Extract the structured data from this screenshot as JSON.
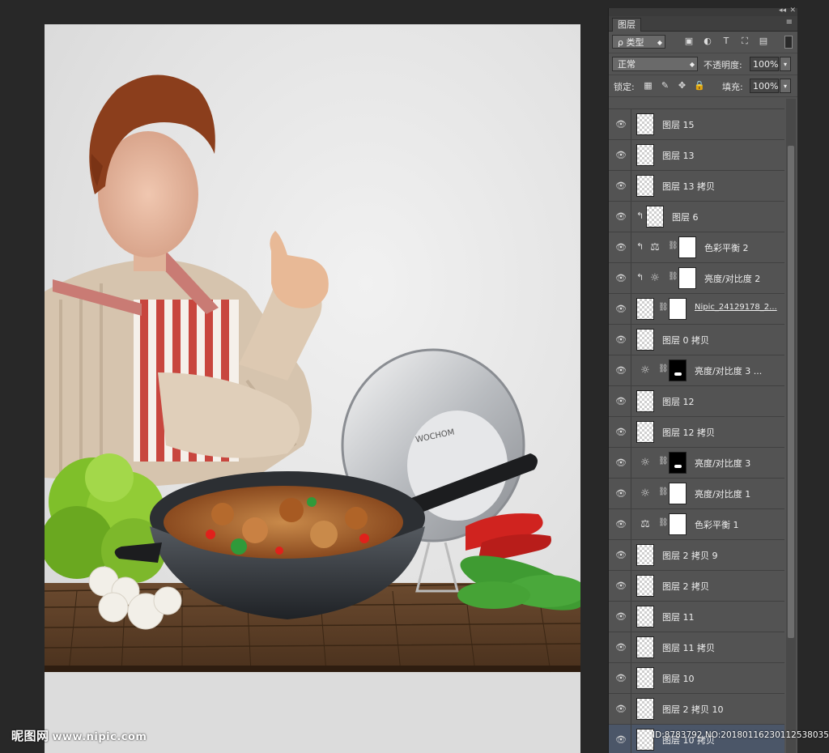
{
  "panel": {
    "tab_label": "图层",
    "kind_filter": "ρ 类型",
    "blend_mode": "正常",
    "opacity_label": "不透明度:",
    "opacity_value": "100%",
    "lock_label": "锁定:",
    "fill_label": "填充:",
    "fill_value": "100%"
  },
  "layers": [
    {
      "name": "",
      "thumb": "checker",
      "partial": true
    },
    {
      "name": "图层 15",
      "thumb": "checker"
    },
    {
      "name": "图层 13",
      "thumb": "checker"
    },
    {
      "name": "图层 13 拷贝",
      "thumb": "checker"
    },
    {
      "name": "图层 6",
      "thumb": "checker",
      "clipped": true
    },
    {
      "name": "色彩平衡 2",
      "adjustment": "balance-icon",
      "mask": "white",
      "clipped": true
    },
    {
      "name": "亮度/对比度 2",
      "adjustment": "sun-icon",
      "mask": "white",
      "clipped": true
    },
    {
      "name": "Nipic_24129178_2...",
      "thumb": "checker",
      "mask": "white",
      "underline": true
    },
    {
      "name": "图层 0 拷贝",
      "thumb": "checker"
    },
    {
      "name": "亮度/对比度 3 ...",
      "adjustment": "sun-icon",
      "mask": "black"
    },
    {
      "name": "图层 12",
      "thumb": "checker"
    },
    {
      "name": "图层 12 拷贝",
      "thumb": "checker"
    },
    {
      "name": "亮度/对比度 3",
      "adjustment": "sun-icon",
      "mask": "black"
    },
    {
      "name": "亮度/对比度 1",
      "adjustment": "sun-icon",
      "mask": "white"
    },
    {
      "name": "色彩平衡 1",
      "adjustment": "balance-icon",
      "mask": "white"
    },
    {
      "name": "图层 2 拷贝 9",
      "thumb": "checker"
    },
    {
      "name": "图层 2 拷贝",
      "thumb": "checker"
    },
    {
      "name": "图层 11",
      "thumb": "checker"
    },
    {
      "name": "图层 11 拷贝",
      "thumb": "checker"
    },
    {
      "name": "图层 10",
      "thumb": "checker"
    },
    {
      "name": "图层 2 拷贝 10",
      "thumb": "checker"
    },
    {
      "name": "图层 10 拷贝",
      "thumb": "checker",
      "selected": true
    }
  ],
  "artwork": {
    "pan_brand": "WOCHOM"
  },
  "watermark": {
    "brand": "昵图网",
    "url": "www.nipic.com",
    "id_text": "ID:8783792 NO:20180116230112538035"
  }
}
